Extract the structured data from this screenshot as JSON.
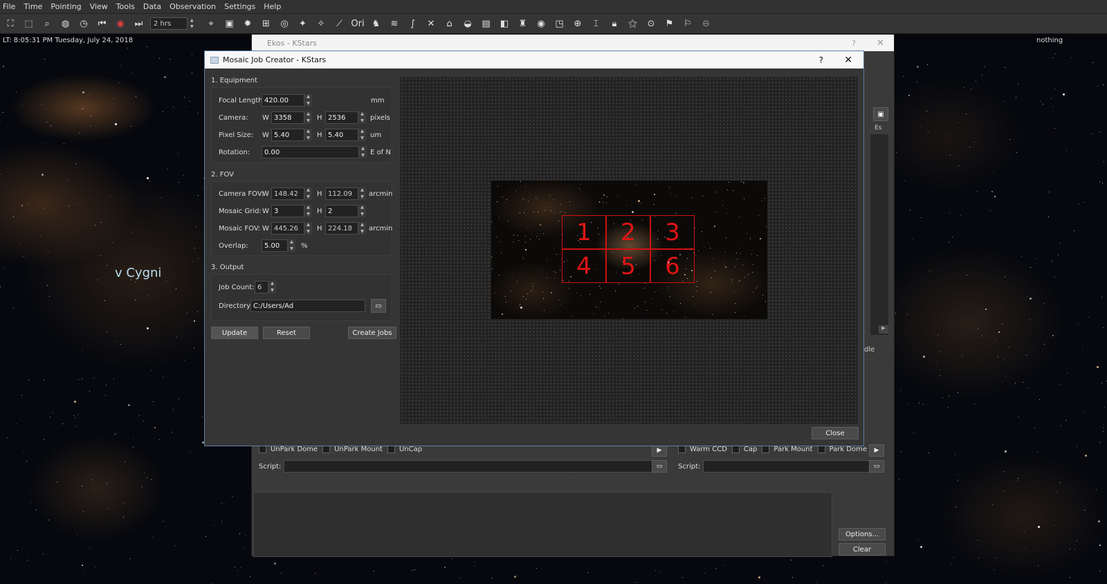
{
  "menu": [
    "File",
    "Time",
    "Pointing",
    "View",
    "Tools",
    "Data",
    "Observation",
    "Settings",
    "Help"
  ],
  "toolbar": {
    "time_step": "2 hrs"
  },
  "status": {
    "local_time": "LT: 8:05:31 PM   Tuesday, July 24, 2018",
    "cursor_object": "nothing"
  },
  "sky": {
    "constellation_label": "v Cygni"
  },
  "ekos": {
    "title": "Ekos - KStars",
    "startup": {
      "unpark_dome": "UnPark Dome",
      "unpark_mount": "UnPark Mount",
      "uncap": "UnCap",
      "script_label": "Script:"
    },
    "shutdown": {
      "warm_ccd": "Warm CCD",
      "cap": "Cap",
      "park_mount": "Park Mount",
      "park_dome": "Park Dome",
      "script_label": "Script:"
    },
    "side_labels": {
      "col_header": "Es",
      "dle": "dle"
    },
    "options_label": "Options...",
    "clear_label": "Clear"
  },
  "mosaic": {
    "title": "Mosaic Job Creator - KStars",
    "equipment": {
      "heading": "1. Equipment",
      "focal_label": "Focal Length:",
      "focal": "420.00",
      "focal_unit": "mm",
      "camera_label": "Camera:",
      "camera_w": "3358",
      "camera_h": "2536",
      "camera_unit": "pixels",
      "pixel_label": "Pixel Size:",
      "pixel_w": "5.40",
      "pixel_h": "5.40",
      "pixel_unit": "um",
      "rotation_label": "Rotation:",
      "rotation": "0.00",
      "rotation_unit": "E of N"
    },
    "fov": {
      "heading": "2. FOV",
      "camfov_label": "Camera FOV:",
      "camfov_w": "148.42",
      "camfov_h": "112.09",
      "camfov_unit": "arcmin",
      "grid_label": "Mosaic Grid:",
      "grid_w": "3",
      "grid_h": "2",
      "mosfov_label": "Mosaic FOV:",
      "mosfov_w": "445.26",
      "mosfov_h": "224.18",
      "mosfov_unit": "arcmin",
      "overlap_label": "Overlap:",
      "overlap": "5.00",
      "overlap_unit": "%"
    },
    "output": {
      "heading": "3. Output",
      "job_label": "Job Count:",
      "job_count": "6",
      "dir_label": "Directory:",
      "directory": "C:/Users/Ad"
    },
    "w": "W",
    "h": "H",
    "buttons": {
      "update": "Update",
      "reset": "Reset",
      "create": "Create Jobs",
      "close": "Close"
    },
    "tiles": [
      "1",
      "2",
      "3",
      "4",
      "5",
      "6"
    ]
  }
}
